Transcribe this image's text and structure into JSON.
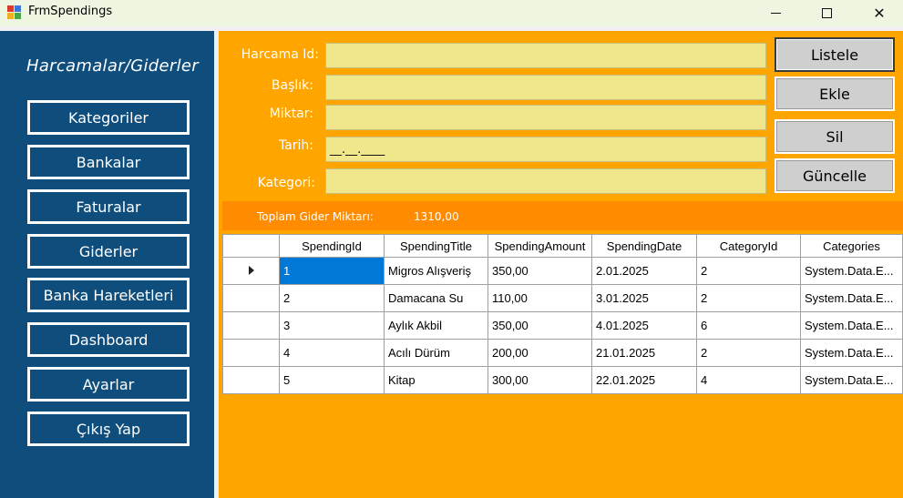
{
  "window": {
    "title": "FrmSpendings",
    "minimize": "—",
    "maximize": "☐",
    "close": "✕"
  },
  "sidebar": {
    "title": "Harcamalar/Giderler",
    "items": [
      "Kategoriler",
      "Bankalar",
      "Faturalar",
      "Giderler",
      "Banka Hareketleri",
      "Dashboard",
      "Ayarlar",
      "Çıkış Yap"
    ]
  },
  "form": {
    "id_label": "Harcama Id:",
    "title_label": "Başlık:",
    "amount_label": "Miktar:",
    "date_label": "Tarih:",
    "category_label": "Kategori:",
    "id_value": "",
    "title_value": "",
    "amount_value": "",
    "date_mask": "__.__.____",
    "category_value": ""
  },
  "actions": {
    "list": "Listele",
    "add": "Ekle",
    "delete": "Sil",
    "update": "Güncelle"
  },
  "total": {
    "label": "Toplam Gider Miktarı:",
    "value": "1310,00"
  },
  "grid": {
    "columns": [
      "SpendingId",
      "SpendingTitle",
      "SpendingAmount",
      "SpendingDate",
      "CategoryId",
      "Categories"
    ],
    "rows": [
      [
        "1",
        "Migros Alışveriş",
        "350,00",
        "2.01.2025",
        "2",
        "System.Data.E..."
      ],
      [
        "2",
        "Damacana Su",
        "110,00",
        "3.01.2025",
        "2",
        "System.Data.E..."
      ],
      [
        "3",
        "Aylık Akbil",
        "350,00",
        "4.01.2025",
        "6",
        "System.Data.E..."
      ],
      [
        "4",
        "Acılı Dürüm",
        "200,00",
        "21.01.2025",
        "2",
        "System.Data.E..."
      ],
      [
        "5",
        "Kitap",
        "300,00",
        "22.01.2025",
        "4",
        "System.Data.E..."
      ]
    ]
  },
  "colors": {
    "sidebar": "#0f4e7c",
    "panel": "#ffa500",
    "totalbar": "#ff8c00",
    "field": "#f0e68c",
    "selection": "#0078d7"
  }
}
